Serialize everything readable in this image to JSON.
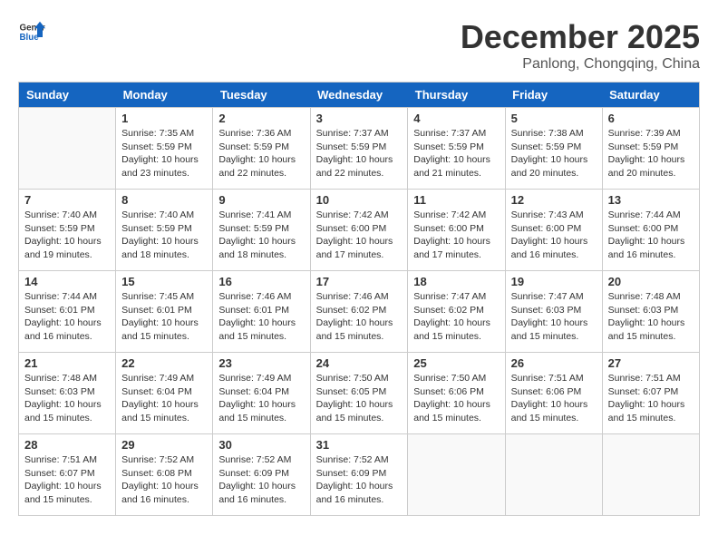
{
  "header": {
    "logo_general": "General",
    "logo_blue": "Blue",
    "month": "December 2025",
    "location": "Panlong, Chongqing, China"
  },
  "days_of_week": [
    "Sunday",
    "Monday",
    "Tuesday",
    "Wednesday",
    "Thursday",
    "Friday",
    "Saturday"
  ],
  "weeks": [
    [
      {
        "day": "",
        "empty": true
      },
      {
        "day": "1",
        "sunrise": "7:35 AM",
        "sunset": "5:59 PM",
        "daylight": "10 hours and 23 minutes."
      },
      {
        "day": "2",
        "sunrise": "7:36 AM",
        "sunset": "5:59 PM",
        "daylight": "10 hours and 22 minutes."
      },
      {
        "day": "3",
        "sunrise": "7:37 AM",
        "sunset": "5:59 PM",
        "daylight": "10 hours and 22 minutes."
      },
      {
        "day": "4",
        "sunrise": "7:37 AM",
        "sunset": "5:59 PM",
        "daylight": "10 hours and 21 minutes."
      },
      {
        "day": "5",
        "sunrise": "7:38 AM",
        "sunset": "5:59 PM",
        "daylight": "10 hours and 20 minutes."
      },
      {
        "day": "6",
        "sunrise": "7:39 AM",
        "sunset": "5:59 PM",
        "daylight": "10 hours and 20 minutes."
      }
    ],
    [
      {
        "day": "7",
        "sunrise": "7:40 AM",
        "sunset": "5:59 PM",
        "daylight": "10 hours and 19 minutes."
      },
      {
        "day": "8",
        "sunrise": "7:40 AM",
        "sunset": "5:59 PM",
        "daylight": "10 hours and 18 minutes."
      },
      {
        "day": "9",
        "sunrise": "7:41 AM",
        "sunset": "5:59 PM",
        "daylight": "10 hours and 18 minutes."
      },
      {
        "day": "10",
        "sunrise": "7:42 AM",
        "sunset": "6:00 PM",
        "daylight": "10 hours and 17 minutes."
      },
      {
        "day": "11",
        "sunrise": "7:42 AM",
        "sunset": "6:00 PM",
        "daylight": "10 hours and 17 minutes."
      },
      {
        "day": "12",
        "sunrise": "7:43 AM",
        "sunset": "6:00 PM",
        "daylight": "10 hours and 16 minutes."
      },
      {
        "day": "13",
        "sunrise": "7:44 AM",
        "sunset": "6:00 PM",
        "daylight": "10 hours and 16 minutes."
      }
    ],
    [
      {
        "day": "14",
        "sunrise": "7:44 AM",
        "sunset": "6:01 PM",
        "daylight": "10 hours and 16 minutes."
      },
      {
        "day": "15",
        "sunrise": "7:45 AM",
        "sunset": "6:01 PM",
        "daylight": "10 hours and 15 minutes."
      },
      {
        "day": "16",
        "sunrise": "7:46 AM",
        "sunset": "6:01 PM",
        "daylight": "10 hours and 15 minutes."
      },
      {
        "day": "17",
        "sunrise": "7:46 AM",
        "sunset": "6:02 PM",
        "daylight": "10 hours and 15 minutes."
      },
      {
        "day": "18",
        "sunrise": "7:47 AM",
        "sunset": "6:02 PM",
        "daylight": "10 hours and 15 minutes."
      },
      {
        "day": "19",
        "sunrise": "7:47 AM",
        "sunset": "6:03 PM",
        "daylight": "10 hours and 15 minutes."
      },
      {
        "day": "20",
        "sunrise": "7:48 AM",
        "sunset": "6:03 PM",
        "daylight": "10 hours and 15 minutes."
      }
    ],
    [
      {
        "day": "21",
        "sunrise": "7:48 AM",
        "sunset": "6:03 PM",
        "daylight": "10 hours and 15 minutes."
      },
      {
        "day": "22",
        "sunrise": "7:49 AM",
        "sunset": "6:04 PM",
        "daylight": "10 hours and 15 minutes."
      },
      {
        "day": "23",
        "sunrise": "7:49 AM",
        "sunset": "6:04 PM",
        "daylight": "10 hours and 15 minutes."
      },
      {
        "day": "24",
        "sunrise": "7:50 AM",
        "sunset": "6:05 PM",
        "daylight": "10 hours and 15 minutes."
      },
      {
        "day": "25",
        "sunrise": "7:50 AM",
        "sunset": "6:06 PM",
        "daylight": "10 hours and 15 minutes."
      },
      {
        "day": "26",
        "sunrise": "7:51 AM",
        "sunset": "6:06 PM",
        "daylight": "10 hours and 15 minutes."
      },
      {
        "day": "27",
        "sunrise": "7:51 AM",
        "sunset": "6:07 PM",
        "daylight": "10 hours and 15 minutes."
      }
    ],
    [
      {
        "day": "28",
        "sunrise": "7:51 AM",
        "sunset": "6:07 PM",
        "daylight": "10 hours and 15 minutes."
      },
      {
        "day": "29",
        "sunrise": "7:52 AM",
        "sunset": "6:08 PM",
        "daylight": "10 hours and 16 minutes."
      },
      {
        "day": "30",
        "sunrise": "7:52 AM",
        "sunset": "6:09 PM",
        "daylight": "10 hours and 16 minutes."
      },
      {
        "day": "31",
        "sunrise": "7:52 AM",
        "sunset": "6:09 PM",
        "daylight": "10 hours and 16 minutes."
      },
      {
        "day": "",
        "empty": true
      },
      {
        "day": "",
        "empty": true
      },
      {
        "day": "",
        "empty": true
      }
    ]
  ]
}
